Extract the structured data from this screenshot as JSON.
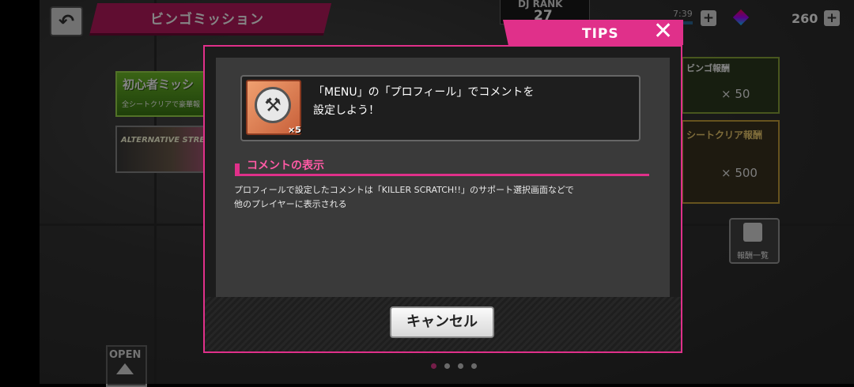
{
  "header": {
    "title": "ビンゴミッション",
    "dj_rank_label": "DJ RANK",
    "dj_rank_value": "27",
    "stamina_timer": "7:39",
    "gem_count": "260"
  },
  "background": {
    "mission_banner_title": "初心者ミッシ",
    "mission_banner_sub": "全シートクリアで豪華報",
    "event_banner_text": "ALTERNATIVE STREET",
    "reward_panel_1_title": "ビンゴ報酬",
    "reward_panel_1_count": "× 50",
    "reward_panel_2_title": "シートクリア報酬",
    "reward_panel_2_count": "× 500",
    "reward_list_label": "報酬一覧",
    "open_label": "OPEN",
    "pager_active_index": 0,
    "pager_count": 4
  },
  "modal": {
    "tab_label": "TIPS",
    "item_text": "「MENU」の「プロフィール」でコメントを\n設定しよう！",
    "item_quantity": "×5",
    "section_heading": "コメントの表示",
    "section_body": "プロフィールで設定したコメントは「KILLER SCRATCH!!」のサポート選択画面などで\n他のプレイヤーに表示される",
    "cancel_label": "キャンセル"
  },
  "colors": {
    "accent_pink": "#e0308a",
    "banner_magenta": "#b8195e"
  }
}
